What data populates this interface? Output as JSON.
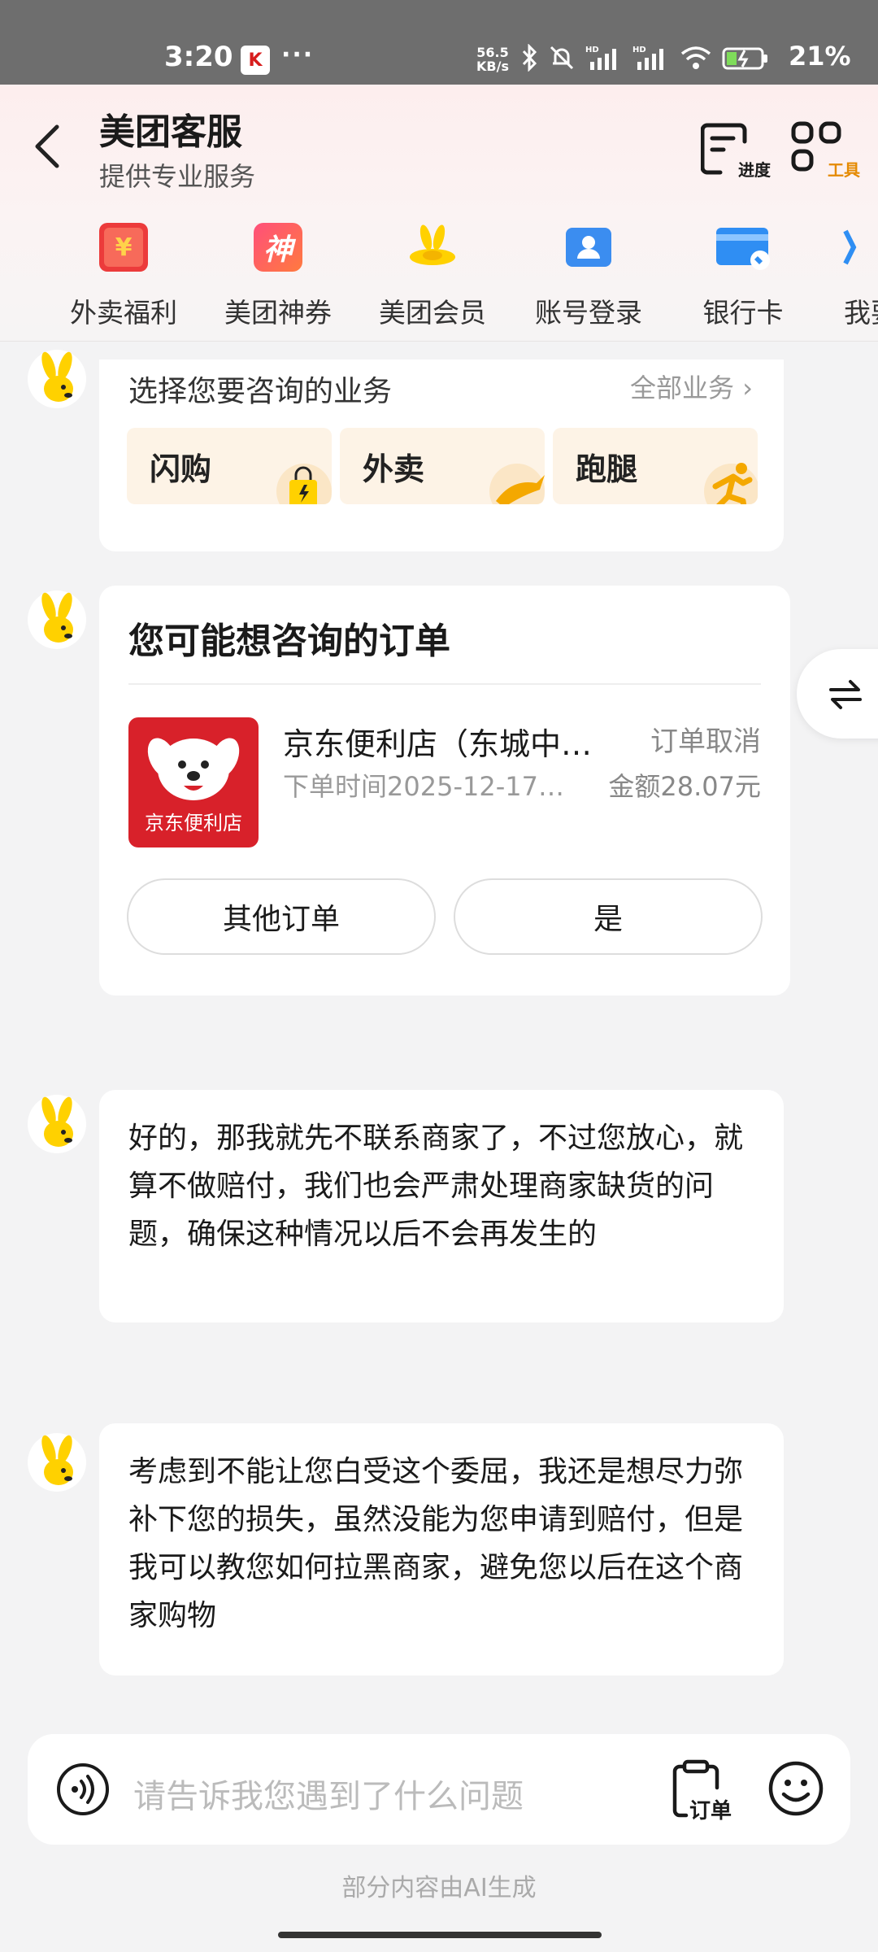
{
  "status_bar": {
    "time": "3:20",
    "app_icon_text": "K",
    "dots": "···",
    "net_speed_value": "56.5",
    "net_speed_unit": "KB/s",
    "battery_percent": "21%"
  },
  "header": {
    "title": "美团客服",
    "subtitle": "提供专业服务",
    "progress_label": "进度",
    "tools_label": "工具"
  },
  "quick_tabs": [
    {
      "label": "外卖福利",
      "icon": "red-envelope-icon",
      "icon_text": "¥"
    },
    {
      "label": "美团神券",
      "icon": "coupon-icon",
      "icon_text": "神"
    },
    {
      "label": "美团会员",
      "icon": "member-icon"
    },
    {
      "label": "账号登录",
      "icon": "account-icon"
    },
    {
      "label": "银行卡",
      "icon": "bank-card-icon"
    },
    {
      "label": "我要",
      "icon": "more-icon"
    }
  ],
  "business_card": {
    "title": "选择您要咨询的业务",
    "all_link": "全部业务",
    "tiles": [
      {
        "label": "闪购",
        "icon": "shopping-bag-icon"
      },
      {
        "label": "外卖",
        "icon": "kangaroo-icon"
      },
      {
        "label": "跑腿",
        "icon": "runner-icon"
      }
    ]
  },
  "order_card": {
    "title": "您可能想咨询的订单",
    "store_name": "京东便利店（东城中…",
    "status": "订单取消",
    "order_time": "下单时间2025-12-17…",
    "amount": "金额28.07元",
    "logo_text": "京东便利店",
    "other_orders_btn": "其他订单",
    "yes_btn": "是"
  },
  "messages": [
    {
      "text": "好的，那我就先不联系商家了，不过您放心，就算不做赔付，我们也会严肃处理商家缺货的问题，确保这种情况以后不会再发生的"
    },
    {
      "text": "考虑到不能让您白受这个委屈，我还是想尽力弥补下您的损失，虽然没能为您申请到赔付，但是我可以教您如何拉黑商家，避免您以后在这个商家购物"
    }
  ],
  "input_bar": {
    "placeholder": "请告诉我您遇到了什么问题",
    "order_label": "订单"
  },
  "footer_note": "部分内容由AI生成",
  "colors": {
    "brand_yellow": "#ffd100",
    "accent_orange": "#e58a00",
    "jd_red": "#d8212a"
  }
}
